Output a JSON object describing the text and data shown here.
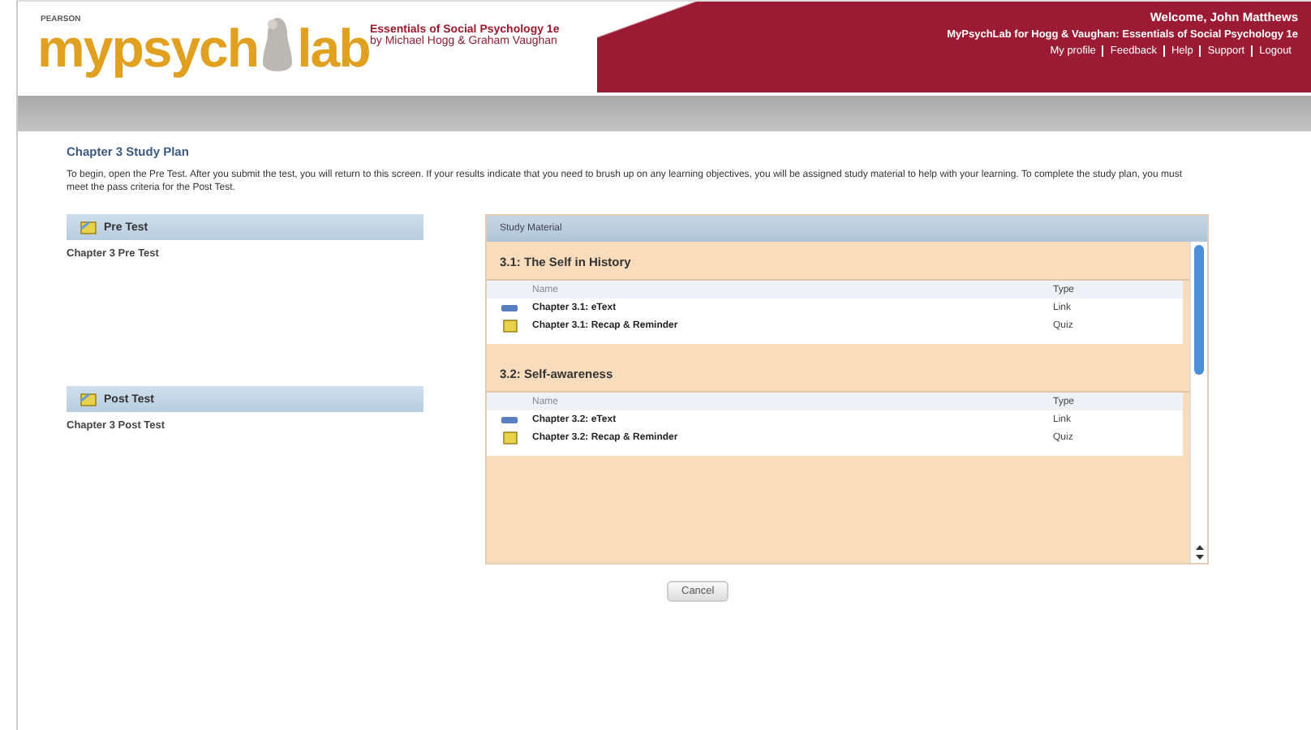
{
  "header": {
    "brand_small": "PEARSON",
    "logo_left": "mypsych",
    "logo_right": "lab",
    "book_title": "Essentials of Social Psychology 1e",
    "book_authors": "by Michael Hogg & Graham Vaughan",
    "welcome": "Welcome, John Matthews",
    "course": "MyPsychLab for Hogg & Vaughan: Essentials of Social Psychology 1e",
    "links": [
      "My profile",
      "Feedback",
      "Help",
      "Support",
      "Logout"
    ]
  },
  "page": {
    "title": "Chapter 3 Study Plan",
    "intro": "To begin, open the Pre Test. After you submit the test, you will return to this screen. If your results indicate that you need to brush up on any learning objectives, you will be assigned study material to help with your learning. To complete the study plan, you must meet the pass criteria for the Post Test."
  },
  "tests": [
    {
      "title": "Pre Test",
      "item": "Chapter 3 Pre Test"
    },
    {
      "title": "Post Test",
      "item": "Chapter 3 Post Test"
    }
  ],
  "study_material": {
    "title": "Study Material",
    "sections": [
      {
        "title": "3.1: The Self in History",
        "columns": [
          "Name",
          "Type"
        ],
        "rows": [
          {
            "kind": "etext",
            "name": "Chapter 3.1: eText",
            "type": "Link"
          },
          {
            "kind": "quiz",
            "name": "Chapter 3.1: Recap & Reminder",
            "type": "Quiz"
          }
        ]
      },
      {
        "title": "3.2: Self-awareness",
        "columns": [
          "Name",
          "Type"
        ],
        "rows": [
          {
            "kind": "etext",
            "name": "Chapter 3.2: eText",
            "type": "Link"
          },
          {
            "kind": "quiz",
            "name": "Chapter 3.2: Recap & Reminder",
            "type": "Quiz"
          }
        ]
      }
    ]
  },
  "buttons": [
    "Cancel"
  ]
}
